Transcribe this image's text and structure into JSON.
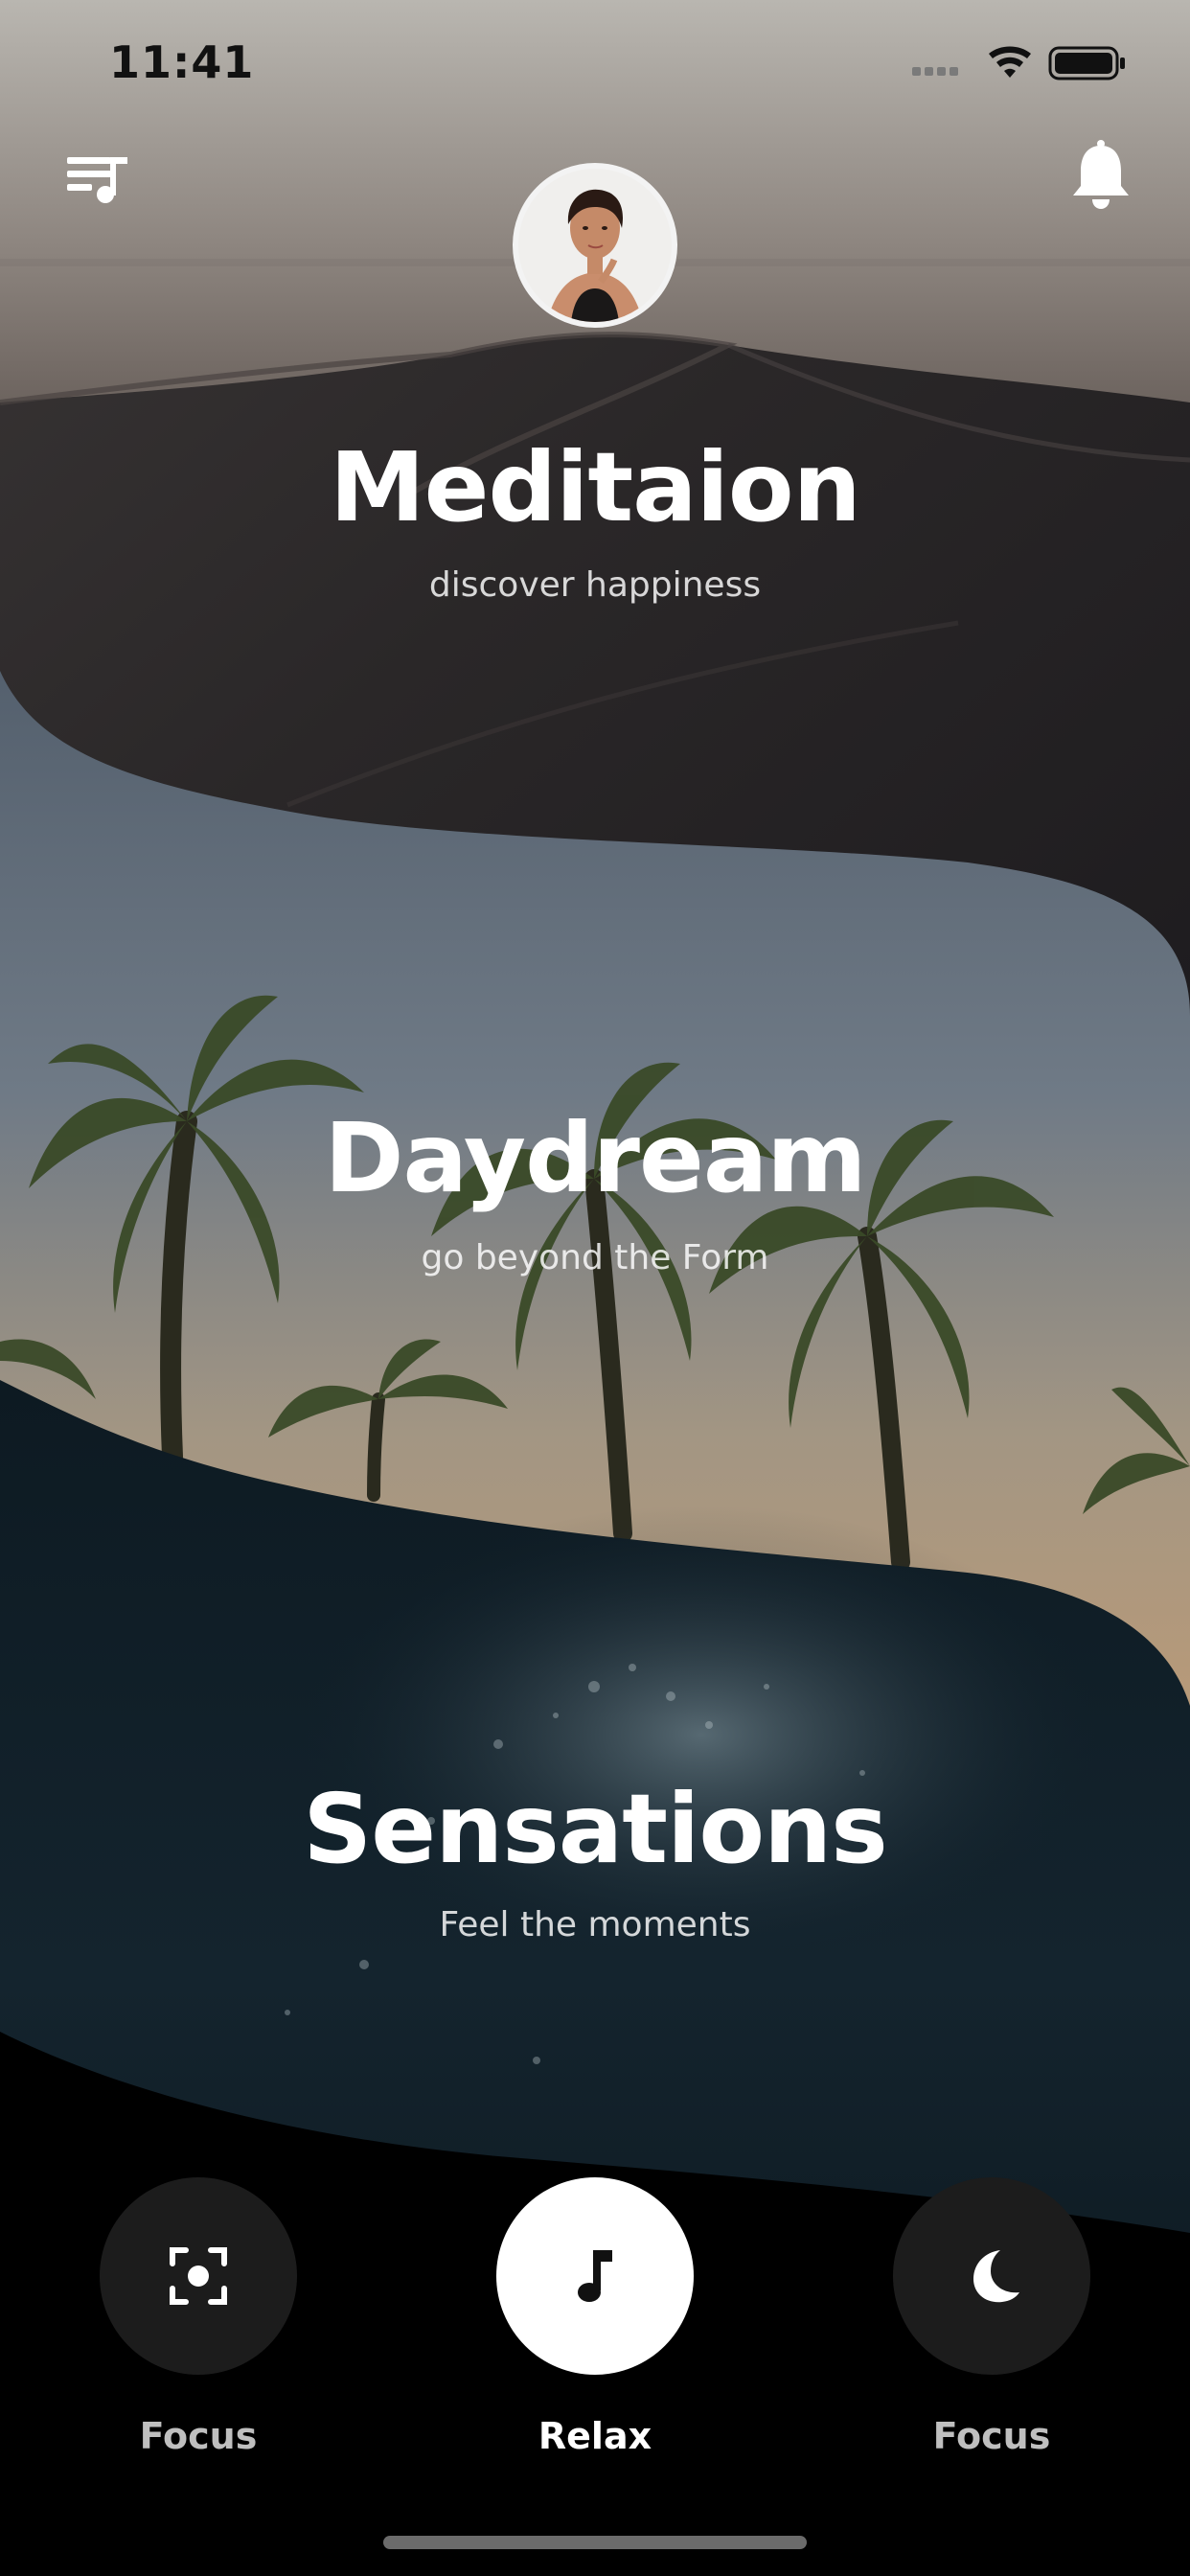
{
  "status_bar": {
    "time": "11:41"
  },
  "header": {
    "menu_icon": "playlist-music-icon",
    "bell_icon": "bell-icon",
    "avatar": "user-avatar"
  },
  "sections": [
    {
      "title": "Meditaion",
      "subtitle": "discover happiness"
    },
    {
      "title": "Daydream",
      "subtitle": "go beyond the Form"
    },
    {
      "title": "Sensations",
      "subtitle": "Feel the moments"
    }
  ],
  "bottom_nav": [
    {
      "label": "Focus",
      "icon": "focus-scan-icon",
      "selected": false
    },
    {
      "label": "Relax",
      "icon": "music-note-icon",
      "selected": true
    },
    {
      "label": "Focus",
      "icon": "moon-icon",
      "selected": false
    }
  ],
  "colors": {
    "background": "#000000",
    "active_nav": "#ffffff",
    "inactive_nav": "#1c1c1c",
    "title_text": "#ffffff"
  }
}
